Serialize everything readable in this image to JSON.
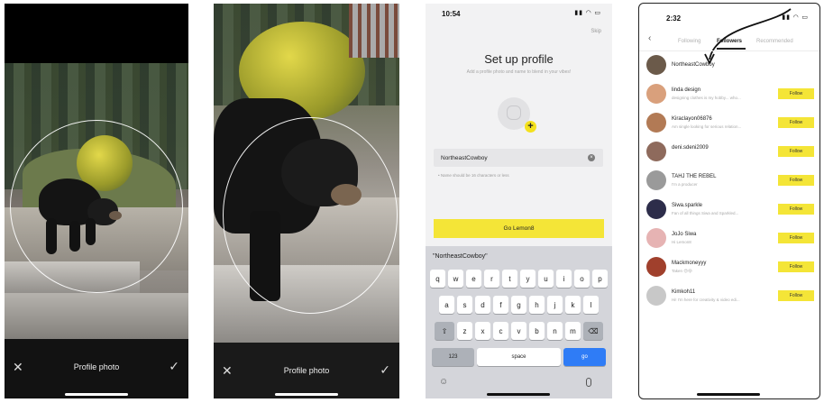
{
  "crop_screen_1": {
    "close_glyph": "✕",
    "title": "Profile photo",
    "confirm_glyph": "✓"
  },
  "crop_screen_2": {
    "close_glyph": "✕",
    "title": "Profile photo",
    "confirm_glyph": "✓"
  },
  "setup_screen": {
    "status_time": "10:54",
    "skip_label": "Skip",
    "title": "Set up profile",
    "subtitle": "Add a profile photo and name to blend in your vibes!",
    "username_value": "NortheastCowboy",
    "hint": "• Name should be 16 characters or less",
    "cta_label": "Go Lemon8",
    "keyboard": {
      "suggestion": "\"NortheastCowboy\"",
      "row1": [
        "q",
        "w",
        "e",
        "r",
        "t",
        "y",
        "u",
        "i",
        "o",
        "p"
      ],
      "row2": [
        "a",
        "s",
        "d",
        "f",
        "g",
        "h",
        "j",
        "k",
        "l"
      ],
      "row3": [
        "z",
        "x",
        "c",
        "v",
        "b",
        "n",
        "m"
      ],
      "numbers_label": "123",
      "space_label": "space",
      "go_label": "go",
      "shift_glyph": "⇧",
      "delete_glyph": "⌫",
      "emoji_glyph": "☺"
    }
  },
  "followers_screen": {
    "status_time": "2:32",
    "back_glyph": "‹",
    "tabs": [
      {
        "label": "Following"
      },
      {
        "label": "Followers"
      },
      {
        "label": "Recommended"
      }
    ],
    "self_user": {
      "name": "NortheastCowboy"
    },
    "follow_label": "Follow",
    "users": [
      {
        "name": "linda design",
        "bio": "designing clothes is my hobby... who...",
        "avatar_color": "#d9a07c"
      },
      {
        "name": "Kiraclayon06876",
        "bio": "Am single looking for serious relation...",
        "avatar_color": "#b27a55"
      },
      {
        "name": "deni.sdeni2009",
        "bio": "",
        "avatar_color": "#8e6a5c"
      },
      {
        "name": "TAHJ THE REBEL",
        "bio": "I'm a producer",
        "avatar_color": "#9a9a9a"
      },
      {
        "name": "Siwa.sparkle",
        "bio": "Fan of all things Siwa and Sparkled...",
        "avatar_color": "#2d2d4a"
      },
      {
        "name": "JoJo Siwa",
        "bio": "Hi Lemon8",
        "avatar_color": "#e6b3b3"
      },
      {
        "name": "Mackmoneyyy",
        "bio": "Taken 😍😝",
        "avatar_color": "#a0402c"
      },
      {
        "name": "Kimkoh11",
        "bio": "Hi! I'm here for creativity & video edi...",
        "avatar_color": "#c8c8c8"
      }
    ]
  }
}
